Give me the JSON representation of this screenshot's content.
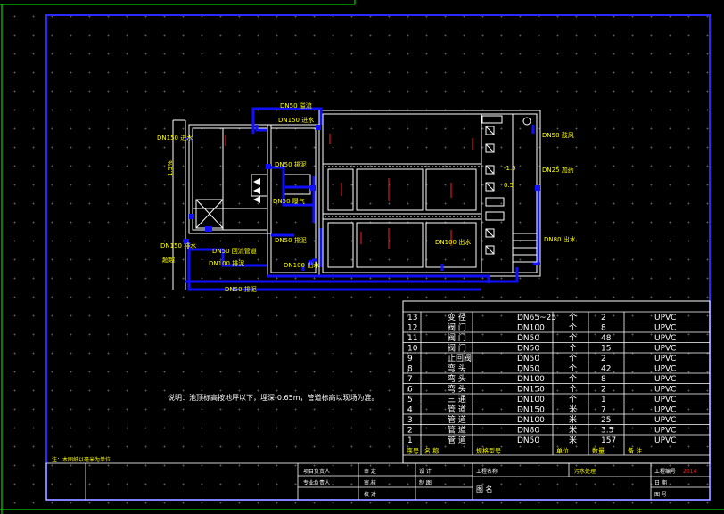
{
  "colors": {
    "pipe": "#1010ff",
    "frame": "#2a2aff",
    "wall": "#ffffff",
    "label": "#ffff00",
    "accent": "#ff2020",
    "green": "#00ff00"
  },
  "pipe_labels": {
    "dn50_top": "DN50 溢流",
    "dn150_top": "DN150 进水",
    "dn150_left": "DN150 进水",
    "slope": "1.5%",
    "dn50_mid": "DN50 排泥",
    "dn50_r1": "DN50 曝气",
    "dn50_r2": "DN50 鼓风",
    "dn25_right": "DN25 加药",
    "dn80_right": "DN80 出水",
    "dn150_lower": "DN150 排水",
    "overflow": "超越",
    "dn50_lower": "DN50 回流管道",
    "dn100_bottom": "DN100 排泥",
    "dn100_lower": "DN100 出水",
    "dn100_right": "DN100 出水",
    "dn50_mid2": "DN50 排泥",
    "dn50_bottom": "DN50 排泥",
    "level1": "-1.5",
    "level2": "0.5"
  },
  "note": "说明：池顶标高按地坪以下，埋深-0.65m，管道标高以现场为准。",
  "corner_note": "注：本图纸以毫米为单位",
  "table": {
    "headers": {
      "no": "序号",
      "name": "名 称",
      "spec": "规格型号",
      "unit": "单位",
      "qty": "数量",
      "note": "备 注"
    },
    "rows": [
      {
        "no": "13",
        "name": "变 径",
        "spec": "DN65~25",
        "unit": "个",
        "qty": "2",
        "note": "UPVC"
      },
      {
        "no": "12",
        "name": "阀 门",
        "spec": "DN100",
        "unit": "个",
        "qty": "8",
        "note": "UPVC"
      },
      {
        "no": "11",
        "name": "阀 门",
        "spec": "DN50",
        "unit": "个",
        "qty": "48",
        "note": "UPVC"
      },
      {
        "no": "10",
        "name": "阀 门",
        "spec": "DN50",
        "unit": "个",
        "qty": "15",
        "note": "UPVC"
      },
      {
        "no": "9",
        "name": "止回阀",
        "spec": "DN50",
        "unit": "个",
        "qty": "2",
        "note": "UPVC"
      },
      {
        "no": "8",
        "name": "弯 头",
        "spec": "DN50",
        "unit": "个",
        "qty": "42",
        "note": "UPVC"
      },
      {
        "no": "7",
        "name": "弯 头",
        "spec": "DN100",
        "unit": "个",
        "qty": "8",
        "note": "UPVC"
      },
      {
        "no": "6",
        "name": "弯 头",
        "spec": "DN150",
        "unit": "个",
        "qty": "2",
        "note": "UPVC"
      },
      {
        "no": "5",
        "name": "三 通",
        "spec": "DN100",
        "unit": "个",
        "qty": "1",
        "note": "UPVC"
      },
      {
        "no": "4",
        "name": "管 道",
        "spec": "DN150",
        "unit": "米",
        "qty": "7",
        "note": "UPVC"
      },
      {
        "no": "3",
        "name": "管 道",
        "spec": "DN100",
        "unit": "米",
        "qty": "25",
        "note": "UPVC"
      },
      {
        "no": "2",
        "name": "管 道",
        "spec": "DN80",
        "unit": "米",
        "qty": "3.5",
        "note": "UPVC"
      },
      {
        "no": "1",
        "name": "管 道",
        "spec": "DN50",
        "unit": "米",
        "qty": "157",
        "note": "UPVC"
      }
    ]
  },
  "title_block": {
    "r1c1": "项目负责人",
    "r1c2": "审 定",
    "r1c3": "设 计",
    "r2c1": "专业负责人",
    "r2c2": "审 核",
    "r2c3": "制 图",
    "r3c2": "校 对",
    "project_name": "工程名称",
    "project_value": "污水处理",
    "drawing_title": "图 名",
    "drawing_no": "工程编号",
    "drawing_no_value": "2014",
    "date": "日 期",
    "sheet_no": "图 号"
  }
}
